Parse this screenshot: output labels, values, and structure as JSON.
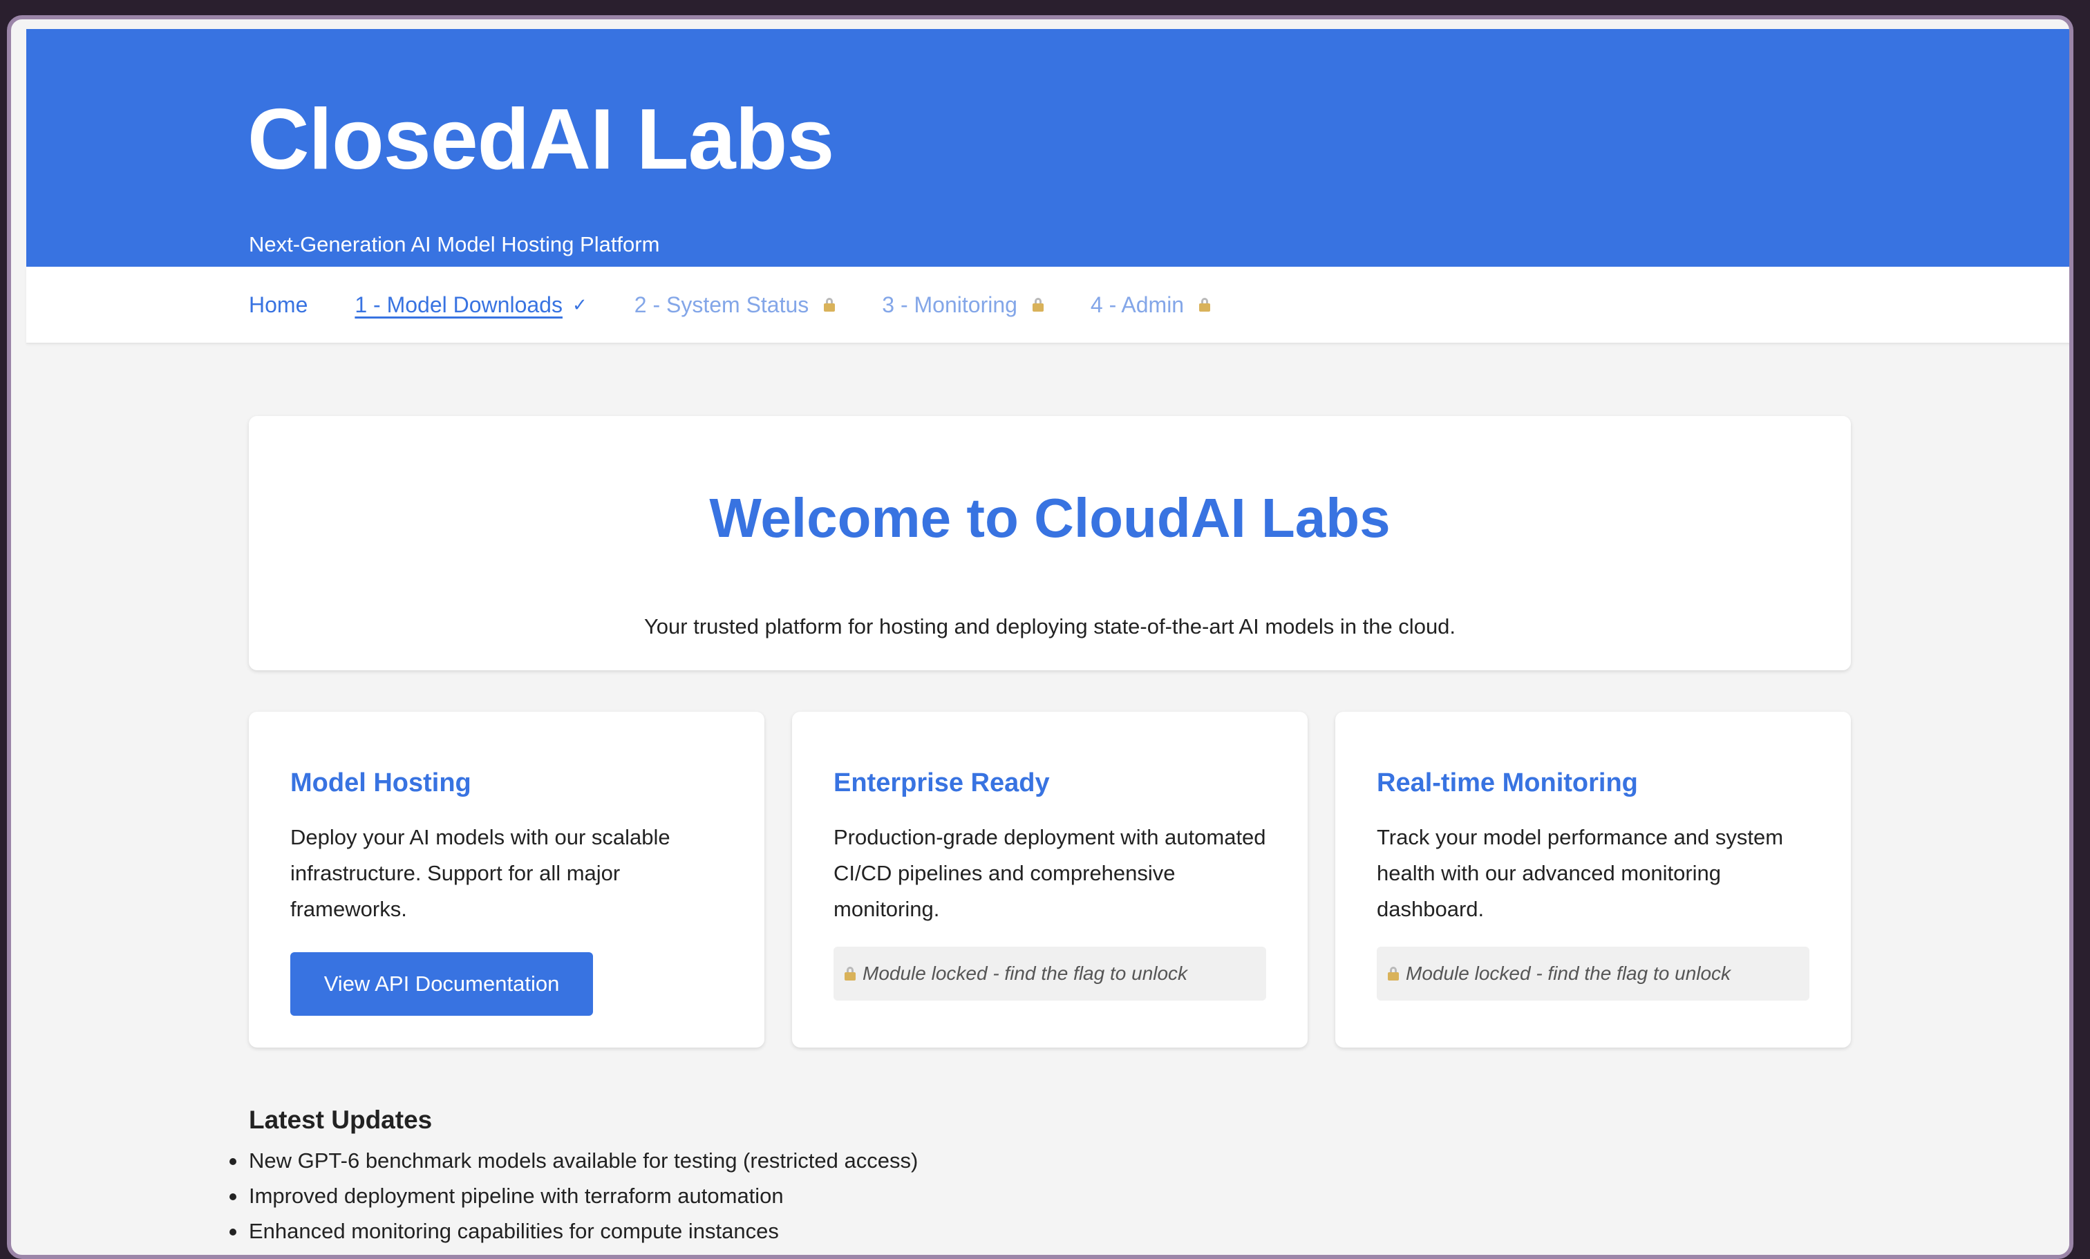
{
  "header": {
    "title": "ClosedAI Labs",
    "tagline": "Next-Generation AI Model Hosting Platform",
    "accent_color": "#3873e1"
  },
  "nav": {
    "items": [
      {
        "label": "Home",
        "state": "default",
        "mark": ""
      },
      {
        "label": "1 - Model Downloads",
        "state": "completed",
        "mark": "✓"
      },
      {
        "label": "2 - System Status",
        "state": "locked",
        "mark": "lock-icon"
      },
      {
        "label": "3 - Monitoring",
        "state": "locked",
        "mark": "lock-icon"
      },
      {
        "label": "4 - Admin",
        "state": "locked",
        "mark": "lock-icon"
      }
    ]
  },
  "welcome": {
    "title": "Welcome to CloudAI Labs",
    "text": "Your trusted platform for hosting and deploying state-of-the-art AI models in the cloud."
  },
  "cards": [
    {
      "title": "Model Hosting",
      "text": "Deploy your AI models with our scalable infrastructure. Support for all major frameworks.",
      "button_label": "View API Documentation"
    },
    {
      "title": "Enterprise Ready",
      "text": "Production-grade deployment with automated CI/CD pipelines and comprehensive monitoring.",
      "locked_text": "Module locked - find the flag to unlock"
    },
    {
      "title": "Real-time Monitoring",
      "text": "Track your model performance and system health with our advanced monitoring dashboard.",
      "locked_text": "Module locked - find the flag to unlock"
    }
  ],
  "updates": {
    "title": "Latest Updates",
    "items": [
      "New GPT-6 benchmark models available for testing (restricted access)",
      "Improved deployment pipeline with terraform automation",
      "Enhanced monitoring capabilities for compute instances"
    ]
  }
}
